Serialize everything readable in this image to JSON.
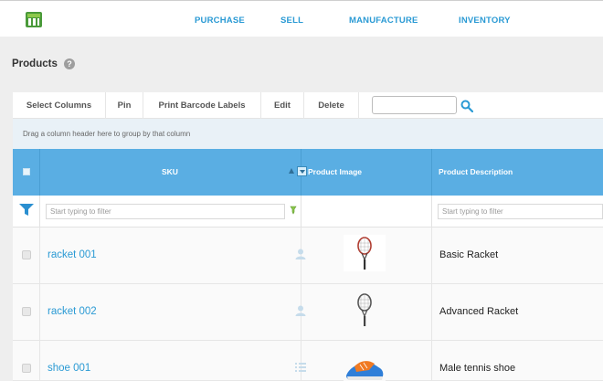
{
  "nav": {
    "items": [
      {
        "label": "PURCHASE"
      },
      {
        "label": "SELL"
      },
      {
        "label": "MANUFACTURE"
      },
      {
        "label": "INVENTORY"
      }
    ]
  },
  "page": {
    "title": "Products",
    "help_icon": "question-circle-icon"
  },
  "toolbar": {
    "select_columns": "Select Columns",
    "pin": "Pin",
    "print_barcode": "Print Barcode Labels",
    "edit": "Edit",
    "delete": "Delete",
    "search_value": "",
    "search_icon": "magnifier-icon"
  },
  "group_bar": {
    "text": "Drag a column header here to group by that column"
  },
  "grid": {
    "columns": [
      "SKU",
      "Product Image",
      "Product Description"
    ],
    "filter_placeholder": "Start typing to filter",
    "rows": [
      {
        "sku": "racket 001",
        "description": "Basic Racket",
        "image": "tennis-racket-image"
      },
      {
        "sku": "racket 002",
        "description": "Advanced Racket",
        "image": "tennis-racket-image"
      },
      {
        "sku": "shoe 001",
        "description": "Male tennis shoe",
        "image": "tennis-shoe-image"
      }
    ]
  },
  "colors": {
    "accent": "#2a9ad4",
    "header_bg": "#5aaee3",
    "content_bg": "#eeeeee"
  }
}
